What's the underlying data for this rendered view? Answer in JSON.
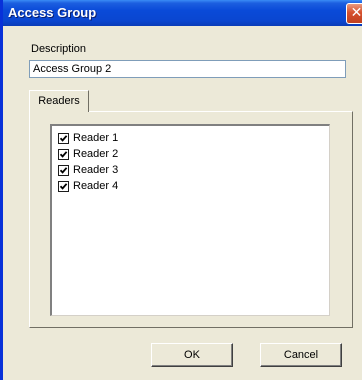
{
  "window": {
    "title": "Access Group",
    "close_glyph": "✕"
  },
  "description": {
    "label": "Description",
    "value": "Access Group 2"
  },
  "tabs": [
    {
      "label": "Readers",
      "selected": true
    }
  ],
  "readers": [
    {
      "label": "Reader 1",
      "checked": true
    },
    {
      "label": "Reader 2",
      "checked": true
    },
    {
      "label": "Reader 3",
      "checked": true
    },
    {
      "label": "Reader 4",
      "checked": true
    }
  ],
  "buttons": {
    "ok_label": "OK",
    "cancel_label": "Cancel"
  },
  "colors": {
    "titlebar": "#0a46d0",
    "close_button": "#d6512e",
    "dialog_face": "#ece9d8"
  }
}
